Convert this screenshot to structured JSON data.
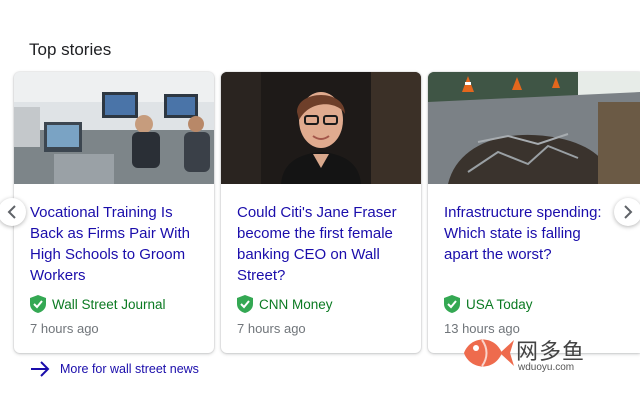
{
  "section": {
    "title": "Top stories"
  },
  "stories": [
    {
      "headline": "Vocational Training Is\nBack as Firms Pair With\nHigh Schools to Groom\nWorkers",
      "source": "Wall Street Journal",
      "time": "7 hours ago",
      "thumbnail_icon": "classroom-photo"
    },
    {
      "headline": "Could Citi's Jane Fraser\nbecome the first female\nbanking CEO on Wall\nStreet?",
      "source": "CNN Money",
      "time": "7 hours ago",
      "thumbnail_icon": "portrait-photo"
    },
    {
      "headline": "Infrastructure spending:\nWhich state is falling\napart the worst?",
      "source": "USA Today",
      "time": "13 hours ago",
      "thumbnail_icon": "road-damage-photo"
    }
  ],
  "more": {
    "label": "More for wall street news"
  },
  "watermark": {
    "cn": "网多鱼",
    "url": "wduoyu.com"
  },
  "colors": {
    "link": "#1a0dab",
    "source": "#0b7a22",
    "verified": "#34a853",
    "meta": "#70757a"
  }
}
